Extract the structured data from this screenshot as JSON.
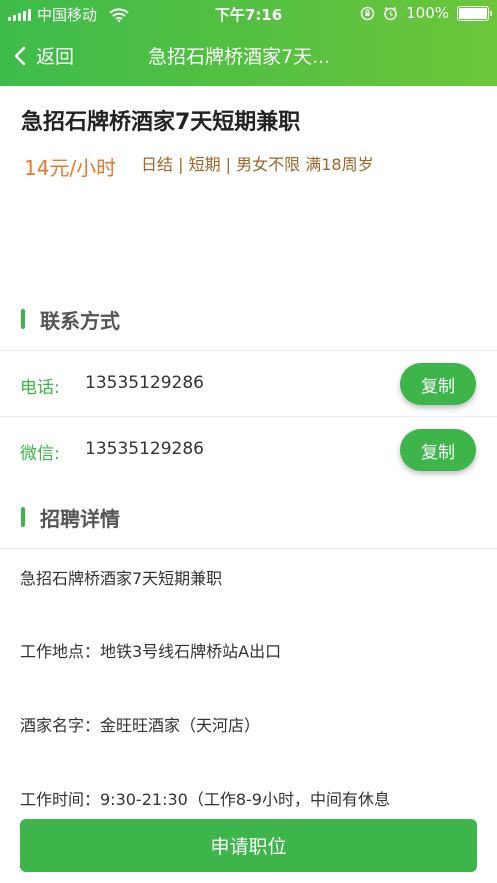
{
  "status_bar": {
    "carrier": "中国移动",
    "time": "下午7:16",
    "battery_text": "100%",
    "battery_level": 1.0
  },
  "nav": {
    "back_label": "返回",
    "title": "急招石牌桥酒家7天..."
  },
  "job": {
    "title": "急招石牌桥酒家7天短期兼职",
    "salary": "14元/小时",
    "tags": "日结 | 短期 | 男女不限 满18周岁"
  },
  "contact": {
    "section_title": "联系方式",
    "rows": [
      {
        "label": "电话:",
        "value": "13535129286",
        "button": "复制"
      },
      {
        "label": "微信:",
        "value": "13535129286",
        "button": "复制"
      }
    ]
  },
  "details": {
    "section_title": "招聘详情",
    "lines": [
      "急招石牌桥酒家7天短期兼职",
      "工作地点：地铁3号线石牌桥站A出口",
      "酒家名字：金旺旺酒家（天河店）",
      "工作时间：9:30-21:30（工作8-9小时，中间有休息"
    ]
  },
  "apply_button": "申请职位",
  "colors": {
    "accent": "#3db54a",
    "salary": "#e8792b",
    "tags": "#a0652a"
  }
}
